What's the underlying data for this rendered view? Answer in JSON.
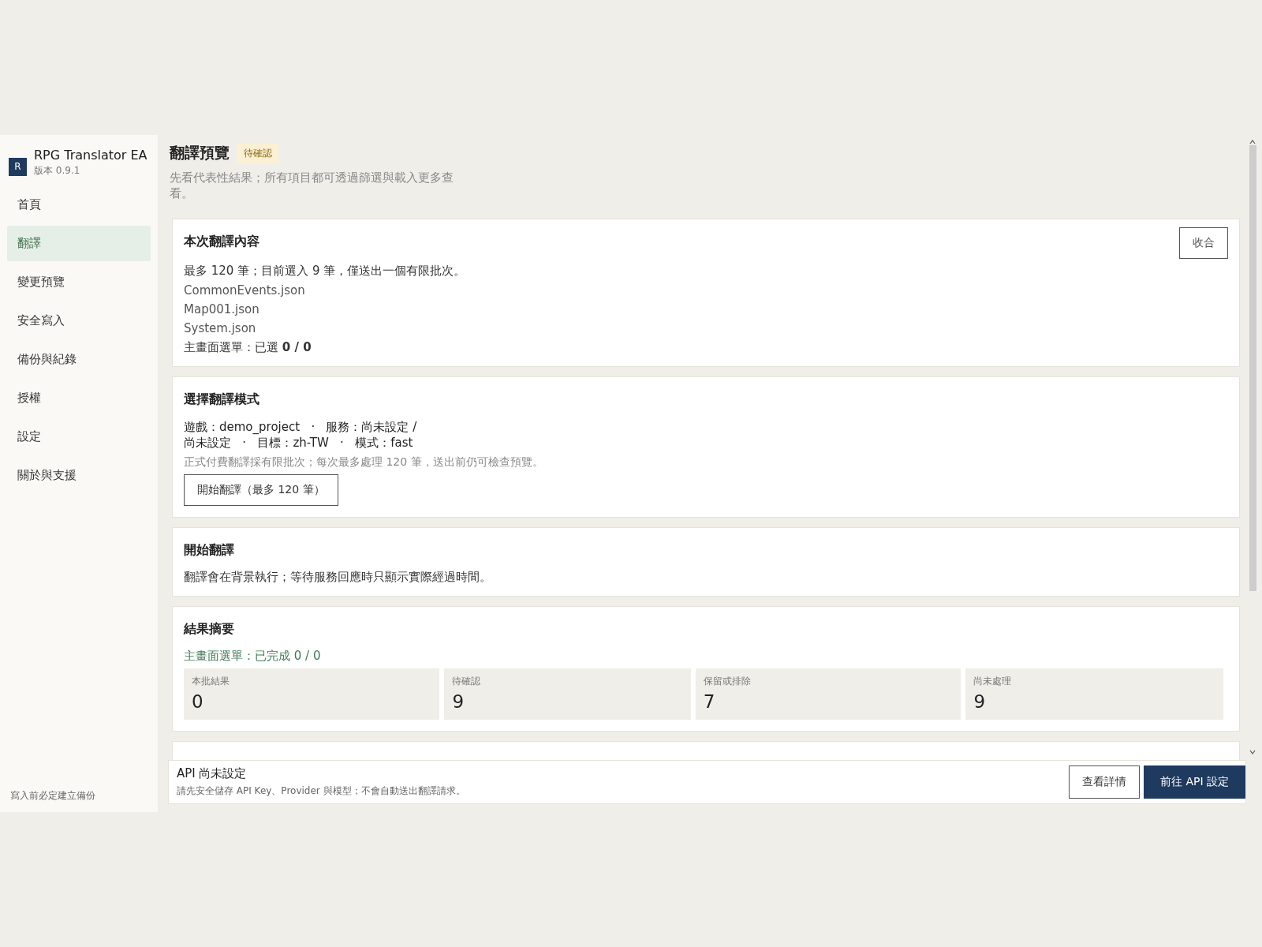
{
  "app": {
    "name": "RPG Translator EA",
    "logo_letter": "R",
    "version": "版本 0.9.1"
  },
  "sidebar": {
    "items": [
      {
        "label": "首頁",
        "selected": false
      },
      {
        "label": "翻譯",
        "selected": true
      },
      {
        "label": "變更預覽",
        "selected": false
      },
      {
        "label": "安全寫入",
        "selected": false
      },
      {
        "label": "備份與紀錄",
        "selected": false
      },
      {
        "label": "授權",
        "selected": false
      },
      {
        "label": "設定",
        "selected": false
      },
      {
        "label": "關於與支援",
        "selected": false
      }
    ],
    "footer": "寫入前必定建立備份"
  },
  "header": {
    "title": "翻譯預覽",
    "badge": "待確認",
    "subtitle": "先看代表性結果；所有項目都可透過篩選與載入更多查看。"
  },
  "content_card": {
    "title": "本次翻譯內容",
    "collapse_button": "收合",
    "summary": "最多 120 筆；目前選入 9 筆，僅送出一個有限批次。",
    "files": [
      "CommonEvents.json",
      "Map001.json",
      "System.json"
    ],
    "menu_selection": "主畫面選單：已選 **0 / 0**"
  },
  "mode_card": {
    "title": "選擇翻譯模式",
    "meta": "遊戲：demo_project   ·   服務：尚未設定 / 尚未設定   ·   目標：zh-TW   ·   模式：fast",
    "note": "正式付費翻譯採有限批次；每次最多處理 120 筆，送出前仍可檢查預覽。",
    "start_button": "開始翻譯（最多 120 筆）"
  },
  "start_card": {
    "title": "開始翻譯",
    "text": "翻譯會在背景執行；等待服務回應時只顯示實際經過時間。"
  },
  "result_card": {
    "title": "結果摘要",
    "progress": "主畫面選單：已完成 0 / 0",
    "stats": [
      {
        "label": "本批結果",
        "value": "0"
      },
      {
        "label": "待確認",
        "value": "9"
      },
      {
        "label": "保留或排除",
        "value": "7"
      },
      {
        "label": "尚未處理",
        "value": "9"
      }
    ]
  },
  "api_bar": {
    "title": "API 尚未設定",
    "text": "請先安全儲存 API Key、Provider 與模型；不會自動送出翻譯請求。",
    "details_button": "查看詳情",
    "settings_button": "前往 API 設定"
  }
}
